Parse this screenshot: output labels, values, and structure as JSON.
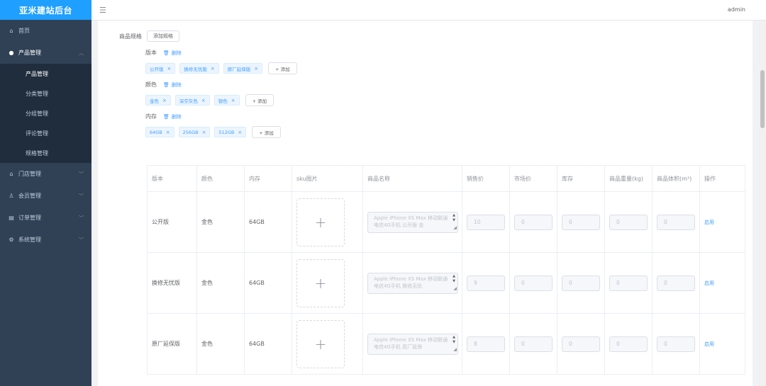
{
  "brand": "亚米建站后台",
  "header": {
    "menu_icon": "hamburger-icon",
    "username": "admin"
  },
  "sidebar": {
    "home": "首页",
    "product": "产品管理",
    "product_sub": [
      "产品管理",
      "分类管理",
      "分组管理",
      "评论管理",
      "规格管理"
    ],
    "store": "门店管理",
    "member": "会员管理",
    "order": "订单管理",
    "system": "系统管理"
  },
  "spec": {
    "label": "商品规格",
    "add_spec": "添加规格",
    "delete": "删除",
    "add": "+ 添加",
    "groups": [
      {
        "name": "版本",
        "tags": [
          "公开版",
          "换修无忧版",
          "原厂延保版"
        ]
      },
      {
        "name": "颜色",
        "tags": [
          "金色",
          "深空灰色",
          "银色"
        ]
      },
      {
        "name": "内存",
        "tags": [
          "64GB",
          "256GB",
          "512GB"
        ]
      }
    ]
  },
  "table": {
    "headers": [
      "版本",
      "颜色",
      "内存",
      "sku图片",
      "商品名称",
      "销售价",
      "市场价",
      "库存",
      "商品重量(kg)",
      "商品体积(m³)",
      "操作"
    ],
    "upload_symbol": "+",
    "rows": [
      {
        "version": "公开版",
        "color": "金色",
        "memory": "64GB",
        "name": "Apple iPhone XS Max 移动联通电信4G手机 公开版 金",
        "price": "10",
        "market": "0",
        "stock": "0",
        "weight": "0",
        "volume": "0",
        "action": "启用"
      },
      {
        "version": "换修无忧版",
        "color": "金色",
        "memory": "64GB",
        "name": "Apple iPhone XS Max 移动联通电信4G手机 换修无忧",
        "price": "9",
        "market": "0",
        "stock": "0",
        "weight": "0",
        "volume": "0",
        "action": "启用"
      },
      {
        "version": "原厂延保版",
        "color": "金色",
        "memory": "64GB",
        "name": "Apple iPhone XS Max 移动联通电信4G手机 原厂延保",
        "price": "8",
        "market": "0",
        "stock": "0",
        "weight": "0",
        "volume": "0",
        "action": "启用"
      }
    ]
  }
}
